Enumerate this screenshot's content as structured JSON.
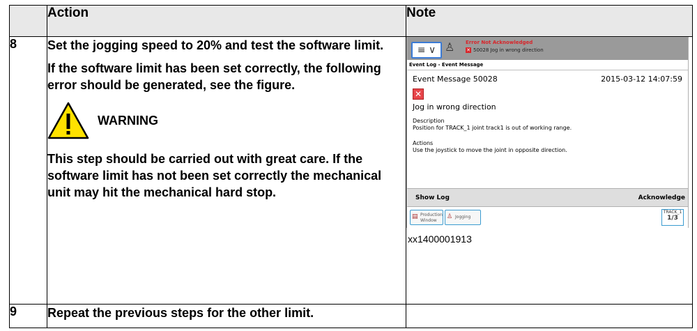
{
  "table": {
    "headers": [
      "",
      "Action",
      "Note"
    ],
    "rows": [
      {
        "num": "8",
        "action_p1": "Set the jogging speed to 20% and test the software limit.",
        "action_p2": "If the software limit has been set correctly, the following error should be generated, see the figure.",
        "warning_label": "WARNING",
        "action_p3": "This step should be carried out with great care. If the software limit has not been set correctly the mechanical unit may hit the mechanical hard stop.",
        "note_caption": "xx1400001913"
      },
      {
        "num": "9",
        "action_p1": "Repeat the previous steps for the other limit.",
        "note_caption": ""
      }
    ]
  },
  "flexpendant": {
    "top_status": "Error Not Acknowledged",
    "top_event": "50028 Jog in wrong direction",
    "breadcrumb": "Event Log - Event Message",
    "message_title": "Event Message 50028",
    "timestamp": "2015-03-12 14:07:59",
    "heading": "Jog in wrong direction",
    "description_label": "Description",
    "description_text": "Position for TRACK_1 joint track1 is out of working range.",
    "actions_label": "Actions",
    "actions_text": "Use the joystick to move the joint in opposite direction.",
    "show_log_label": "Show Log",
    "acknowledge_label": "Acknowledge",
    "task1_label": "Production Window",
    "task2_label": "Jogging",
    "track_label": "TRACK_1",
    "track_fraction": "1/3"
  },
  "colors": {
    "header_bg": "#e8e8e8",
    "warning_yellow": "#ffe200",
    "error_red": "#e7454a",
    "focus_blue": "#3b7bd5"
  }
}
